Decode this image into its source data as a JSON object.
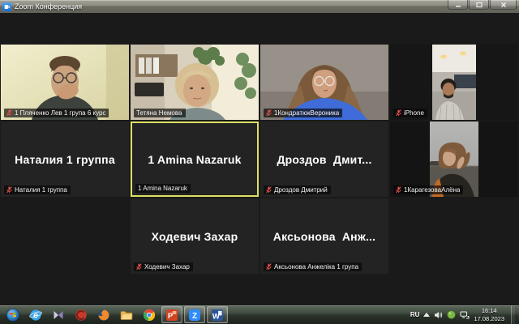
{
  "window": {
    "title": "Zoom Конференция"
  },
  "colors": {
    "active_speaker_border": "#dde063",
    "muted_mic_red": "#e0524a",
    "zoom_blue": "#2d8cff",
    "client_background": "#1a1a1a"
  },
  "grid": {
    "rows": [
      {
        "tiles": [
          {
            "kind": "video",
            "scene": "man-glasses-hand",
            "label": "1 Пляченко Лев 1 група 6 курс",
            "muted": true
          },
          {
            "kind": "video",
            "scene": "woman-office",
            "label": "Тетяна Немова",
            "muted": false
          },
          {
            "kind": "video",
            "scene": "woman-blue-sweater",
            "label": "1КондратюкВероника",
            "muted": true
          },
          {
            "kind": "video",
            "scene": "man-kitchen-portrait",
            "label": "iPhone",
            "muted": true
          }
        ]
      },
      {
        "tiles": [
          {
            "kind": "name",
            "display": "Наталия 1 группа",
            "label": "Наталия 1 группа",
            "muted": true
          },
          {
            "kind": "name",
            "display": "1 Amina Nazaruk",
            "label": "1 Amina Nazaruk",
            "muted": false,
            "active": true
          },
          {
            "kind": "name",
            "display": "Дроздов  Дмит...",
            "label": "Дроздов Дмитрий",
            "muted": true
          },
          {
            "kind": "video",
            "scene": "woman-river-portrait",
            "label": "1КарагезоваАлёна",
            "muted": true
          }
        ]
      },
      {
        "tiles": [
          {
            "kind": "name",
            "display": "Ходевич Захар",
            "label": "Ходевич Захар",
            "muted": true
          },
          {
            "kind": "name",
            "display": "Аксьонова  Анж...",
            "label": "Аксьонова Анжеліка 1 група",
            "muted": true
          }
        ]
      }
    ]
  },
  "taskbar": {
    "apps": [
      "start",
      "internet-explorer",
      "kmplayer",
      "ccleaner",
      "firefox",
      "file-explorer",
      "chrome",
      "powerpoint",
      "zoom",
      "word"
    ],
    "running_apps": [
      "powerpoint",
      "zoom",
      "word"
    ],
    "tray": {
      "language": "RU",
      "time": "16:14",
      "date": "17.08.2023"
    }
  }
}
